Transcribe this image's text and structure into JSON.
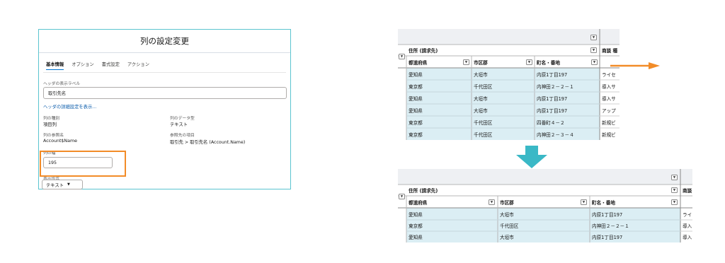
{
  "dialog": {
    "title": "列の設定変更",
    "tabs": [
      "基本情報",
      "オプション",
      "書式設定",
      "アクション"
    ],
    "header_label": "ヘッダの表示ラベル",
    "header_value": "取引先名",
    "detail_link": "ヘッダの詳細設定を表示...",
    "column_type_label": "列の種別",
    "column_type_value": "項目列",
    "data_type_label": "列のデータ型",
    "data_type_value": "テキスト",
    "ref_name_label": "列の参照名",
    "ref_name_value": "Account$Name",
    "ref_field_label": "参照先の項目",
    "ref_field_value": "取引先 > 取引先名 (Account.Name)",
    "width_label": "列の幅",
    "width_value": "195",
    "display_format_label": "表示形式",
    "display_format_value": "テキスト"
  },
  "top_grid": {
    "group_header": "住所 (請求先)",
    "next_group_header": "商談 種",
    "columns": [
      "都道府県",
      "市区郡",
      "町名・番地"
    ],
    "rows": [
      [
        "愛知県",
        "大垣市",
        "内原1丁目197",
        "ライセ"
      ],
      [
        "東京都",
        "千代田区",
        "内神田２－２－１",
        "導入サ"
      ],
      [
        "愛知県",
        "大垣市",
        "内原1丁目197",
        "導入サ"
      ],
      [
        "愛知県",
        "大垣市",
        "内原1丁目197",
        "アップ"
      ],
      [
        "東京都",
        "千代田区",
        "四番町４－２",
        "新規ビ"
      ],
      [
        "東京都",
        "千代田区",
        "内神田２－３－４",
        "新規ビ"
      ]
    ]
  },
  "bottom_grid": {
    "group_header": "住所 (請求先)",
    "next_group_header": "商談",
    "columns": [
      "都道府県",
      "市区郡",
      "町名・番地"
    ],
    "rows": [
      [
        "愛知県",
        "大垣市",
        "内原1丁目197",
        "ライ"
      ],
      [
        "東京都",
        "千代田区",
        "内神田２－２－１",
        "導入"
      ],
      [
        "愛知県",
        "大垣市",
        "内原1丁目197",
        "導入"
      ]
    ]
  },
  "icons": {
    "dropdown": "chevron-down-icon",
    "arrow_right": "arrow-right-icon",
    "arrow_down": "arrow-down-icon"
  },
  "colors": {
    "accent_orange": "#f28c28",
    "arrow_teal": "#3ab8c6",
    "cell_blue": "#dbeef4",
    "link_blue": "#0b5cab",
    "tab_blue": "#0176d3"
  }
}
